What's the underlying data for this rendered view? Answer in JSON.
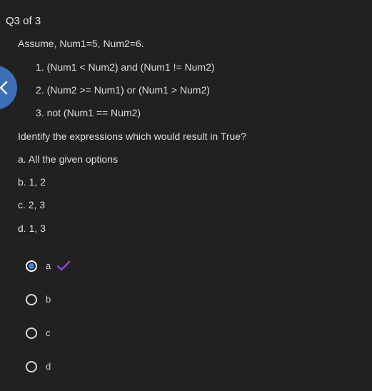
{
  "header": {
    "question_counter": "Q3 of 3"
  },
  "question": {
    "intro": "Assume, Num1=5, Num2=6.",
    "expressions": [
      "1. (Num1 < Num2) and (Num1 != Num2)",
      "2. (Num2 >= Num1) or (Num1 > Num2)",
      "3. not (Num1 == Num2)"
    ],
    "prompt": "Identify the expressions which would result in True?",
    "choices": [
      "a. All the given options",
      "b. 1, 2",
      "c. 2, 3",
      "d. 1, 3"
    ]
  },
  "answers": {
    "options": [
      {
        "label": "a",
        "selected": true,
        "correct_mark": true
      },
      {
        "label": "b",
        "selected": false,
        "correct_mark": false
      },
      {
        "label": "c",
        "selected": false,
        "correct_mark": false
      },
      {
        "label": "d",
        "selected": false,
        "correct_mark": false
      }
    ]
  },
  "icons": {
    "back": "chevron-left-icon",
    "check": "checkmark-icon"
  },
  "colors": {
    "background": "#212121",
    "accent": "#3d6fb6",
    "radio_fill": "#3f86e0",
    "check": "#9b46d6"
  }
}
